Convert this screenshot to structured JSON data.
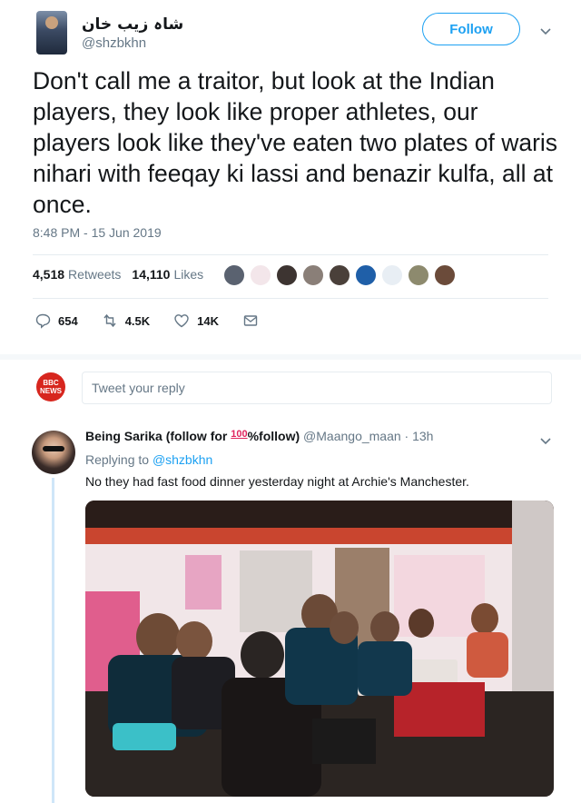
{
  "tweet": {
    "display_name": "شاہ زیب خان",
    "handle": "@shzbkhn",
    "follow_label": "Follow",
    "text": "Don't call me a traitor, but look at the Indian players, they look like proper athletes, our players look like they've eaten two plates of waris nihari with feeqay ki lassi and benazir kulfa, all at once.",
    "timestamp": "8:48 PM - 15 Jun 2019",
    "retweets_count": "4,518",
    "retweets_label": "Retweets",
    "likes_count": "14,110",
    "likes_label": "Likes",
    "actions": {
      "replies": "654",
      "retweets": "4.5K",
      "likes": "14K"
    }
  },
  "reply_box": {
    "placeholder": "Tweet your reply",
    "avatar_text_top": "BBC",
    "avatar_text_bottom": "NEWS"
  },
  "reply": {
    "name_prefix": "Being Sarika (follow for ",
    "name_emoji": "100",
    "name_suffix": "%follow)",
    "handle_time": "@Maango_maan · 13h",
    "replying_prefix": "Replying to ",
    "replying_to": "@shzbkhn",
    "text": "No they had fast food dinner yesterday night at Archie's Manchester."
  },
  "icons": {
    "chevron": "chevron-down-icon",
    "reply": "reply-icon",
    "retweet": "retweet-icon",
    "like": "heart-icon",
    "dm": "envelope-icon"
  },
  "colors": {
    "accent": "#1da1f2",
    "text": "#14171a",
    "muted": "#657786",
    "bbc_red": "#d7261e"
  }
}
